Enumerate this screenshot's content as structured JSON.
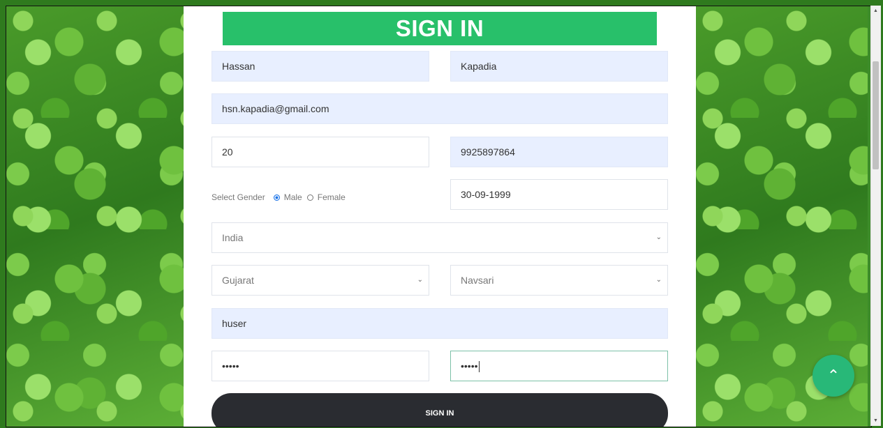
{
  "form": {
    "title": "SIGN IN",
    "first_name": "Hassan",
    "last_name": "Kapadia",
    "email": "hsn.kapadia@gmail.com",
    "age": "20",
    "phone": "9925897864",
    "gender": {
      "label": "Select Gender",
      "options": [
        "Male",
        "Female"
      ],
      "selected": "Male"
    },
    "dob": "30-09-1999",
    "country": "India",
    "state": "Gujarat",
    "city": "Navsari",
    "username": "huser",
    "password": "•••••",
    "confirm_password": "•••••",
    "submit_label": "SIGN IN"
  },
  "icons": {
    "scroll_top": "chevron-up-icon",
    "select_arrow": "chevron-down-icon"
  },
  "colors": {
    "title_bar": "#28c06a",
    "filled_field": "#e8efff",
    "submit_button": "#2a2c31",
    "fab": "#28b878"
  }
}
